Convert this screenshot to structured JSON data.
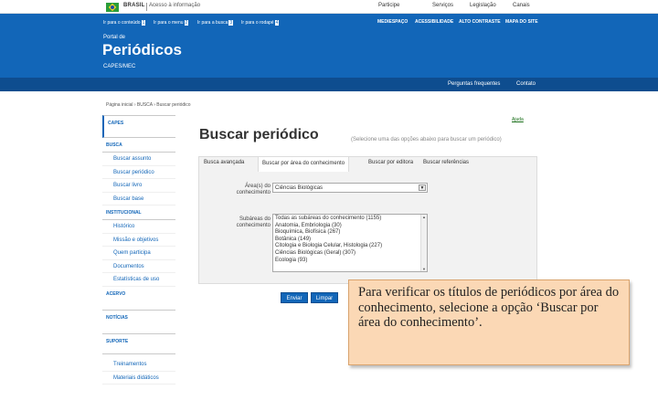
{
  "gov_bar": {
    "country": "BRASIL",
    "access_info": "Acesso à informação",
    "menu": [
      "Participe",
      "Serviços",
      "Legislação",
      "Canais"
    ]
  },
  "accessibility_links": [
    {
      "label": "Ir para o conteúdo",
      "key": "1"
    },
    {
      "label": "Ir para o menu",
      "key": "2"
    },
    {
      "label": "Ir para a busca",
      "key": "3"
    },
    {
      "label": "Ir para o rodapé",
      "key": "4"
    }
  ],
  "header_links": [
    "MEDIESPAÇO",
    "ACESSIBILIDADE",
    "ALTO CONTRASTE",
    "MAPA DO SITE"
  ],
  "portal": {
    "label": "Portal de",
    "title": "Periódicos",
    "subtitle": "CAPES/MEC"
  },
  "nav": [
    "Perguntas frequentes",
    "Contato"
  ],
  "breadcrumb": "Página inicial › BUSCA › Buscar periódico",
  "sidebar": {
    "capes": "CAPES",
    "sections": [
      {
        "title": "BUSCA",
        "items": [
          "Buscar assunto",
          "Buscar periódico",
          "Buscar livro",
          "Buscar base"
        ]
      },
      {
        "title": "INSTITUCIONAL",
        "items": [
          "Histórico",
          "Missão e objetivos",
          "Quem participa",
          "Documentos",
          "Estatísticas de uso"
        ]
      },
      {
        "title": "ACERVO",
        "items": []
      },
      {
        "title": "NOTÍCIAS",
        "items": []
      },
      {
        "title": "SUPORTE",
        "items": [
          "Treinamentos",
          "Materiais didáticos"
        ]
      }
    ]
  },
  "main": {
    "help": "Ajuda",
    "title": "Buscar periódico",
    "hint": "(Selecione uma das opções abaixo para buscar um periódico)",
    "tabs": [
      "Busca avançada",
      "Buscar por área do conhecimento",
      "Buscar por editora",
      "Buscar referências"
    ],
    "area_label": "Área(s) do conhecimento",
    "area_value": "Ciências Biológicas",
    "subareas_label": "Subáreas do conhecimento",
    "subareas": [
      "Todas as subáreas do conhecimento (1155)",
      "Anatomia, Embriologia (30)",
      "Bioquímica, Biofísica (267)",
      "Botânica (149)",
      "Citologia e Biologia Celular, Histologia (227)",
      "Ciências Biológicas (Geral) (307)",
      "Ecologia (93)"
    ],
    "buttons": {
      "send": "Enviar",
      "clear": "Limpar"
    }
  },
  "callout": "Para verificar os títulos de periódicos por área do conhecimento, selecione a opção ‘Buscar por área do conhecimento’.",
  "colors": {
    "header_blue": "#1266b8",
    "nav_blue": "#0e4d8f",
    "callout_bg": "#fbd8b5"
  }
}
